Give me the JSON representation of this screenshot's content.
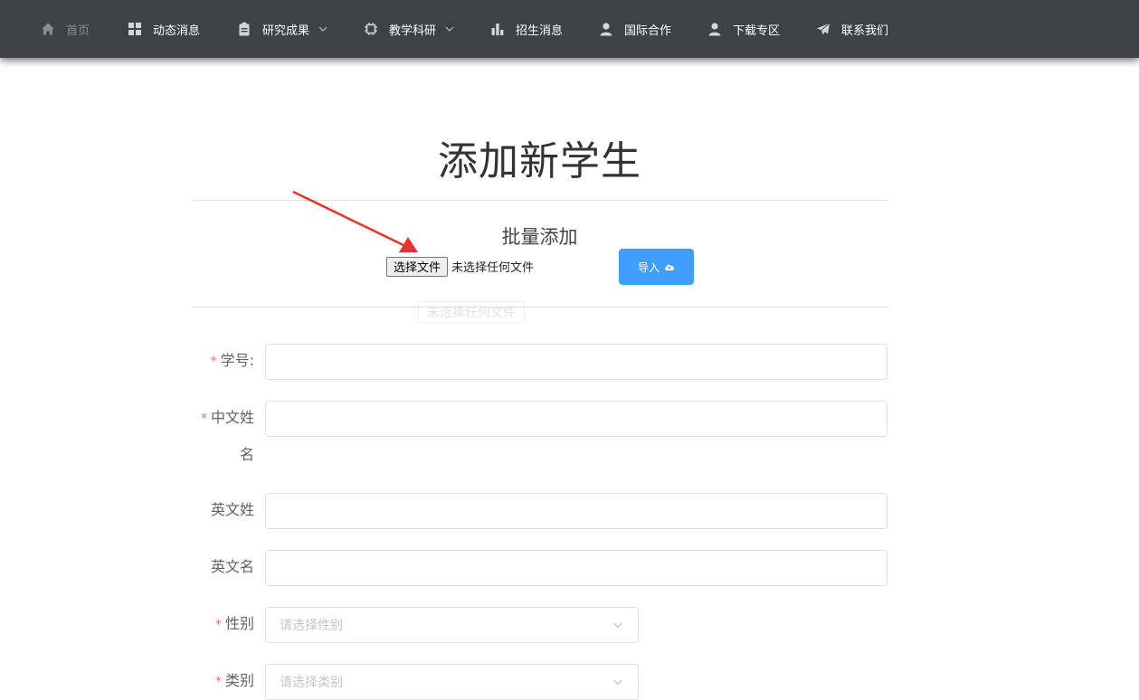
{
  "nav": {
    "items": [
      {
        "label": "首页",
        "icon": "home-icon"
      },
      {
        "label": "动态消息",
        "icon": "grid-icon"
      },
      {
        "label": "研究成果",
        "icon": "clipboard-icon",
        "dropdown": true
      },
      {
        "label": "教学科研",
        "icon": "chip-icon",
        "dropdown": true
      },
      {
        "label": "招生消息",
        "icon": "bar-chart-icon"
      },
      {
        "label": "国际合作",
        "icon": "user-icon"
      },
      {
        "label": "下载专区",
        "icon": "user-icon"
      },
      {
        "label": "联系我们",
        "icon": "send-icon"
      }
    ]
  },
  "page": {
    "title": "添加新学生",
    "batch_title": "批量添加",
    "file_button": "选择文件",
    "file_status": "未选择任何文件",
    "import_button": "导入",
    "ghost_tip": "未选择任何文件"
  },
  "form": {
    "student_id_label": "学号:",
    "cn_name_label_1": "中文姓",
    "cn_name_label_2": "名",
    "en_lastname_label": "英文姓",
    "en_firstname_label": "英文名",
    "gender_label": "性别",
    "gender_placeholder": "请选择性别",
    "type_label": "类别",
    "type_placeholder": "请选择类别"
  },
  "colors": {
    "nav_bg": "#3f4244",
    "primary": "#409eff",
    "required": "#f56c6c",
    "annotation_arrow": "#e8322f"
  }
}
